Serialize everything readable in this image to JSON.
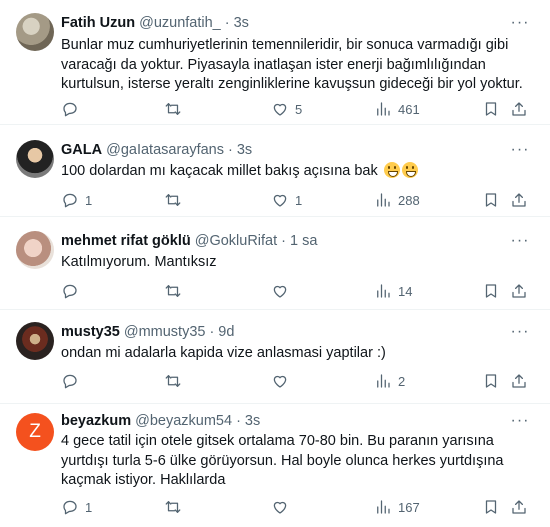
{
  "tweets": [
    {
      "name": "Fatih Uzun",
      "handle": "@uzunfatih_",
      "time": "3s",
      "text": "Bunlar muz cumhuriyetlerinin temennileridir, bir sonuca varmadığı gibi varacağı da yoktur. Piyasayla inatlaşan ister enerji bağımlılığından kurtulsun, isterse yeraltı zenginliklerine kavuşsun gideceği bir yol yoktur.",
      "replies": "",
      "retweets": "",
      "likes": "5",
      "views": "461",
      "avatar": ""
    },
    {
      "name": "GALA",
      "handle": "@gaIatasarayfans",
      "time": "3s",
      "text": "100 dolardan mı kaçacak millet bakış açısına bak",
      "replies": "1",
      "retweets": "",
      "likes": "1",
      "views": "288",
      "avatar": ""
    },
    {
      "name": "mehmet rifat göklü",
      "handle": "@GokluRifat",
      "time": "1 sa",
      "text": "Katılmıyorum. Mantıksız",
      "replies": "",
      "retweets": "",
      "likes": "",
      "views": "14",
      "avatar": ""
    },
    {
      "name": "musty35",
      "handle": "@mmusty35",
      "time": "9d",
      "text": "ondan mi adalarla kapida vize anlasmasi yaptilar :)",
      "replies": "",
      "retweets": "",
      "likes": "",
      "views": "2",
      "avatar": ""
    },
    {
      "name": "beyazkum",
      "handle": "@beyazkum54",
      "time": "3s",
      "text": "4 gece tatil için otele gitsek ortalama 70-80 bin. Bu paranın yarısına yurtdışı turla 5-6 ülke görüyorsun. Hal boyle olunca herkes yurtdışına kaçmak istiyor. Haklılarda",
      "replies": "1",
      "retweets": "",
      "likes": "",
      "views": "167",
      "avatar": "Z"
    }
  ],
  "ui": {
    "separator": "·",
    "more": "···"
  },
  "colors": {
    "text": "#0f1419",
    "secondary": "#536471",
    "border": "#eff3f4",
    "avatar_z": "#f4511e"
  }
}
